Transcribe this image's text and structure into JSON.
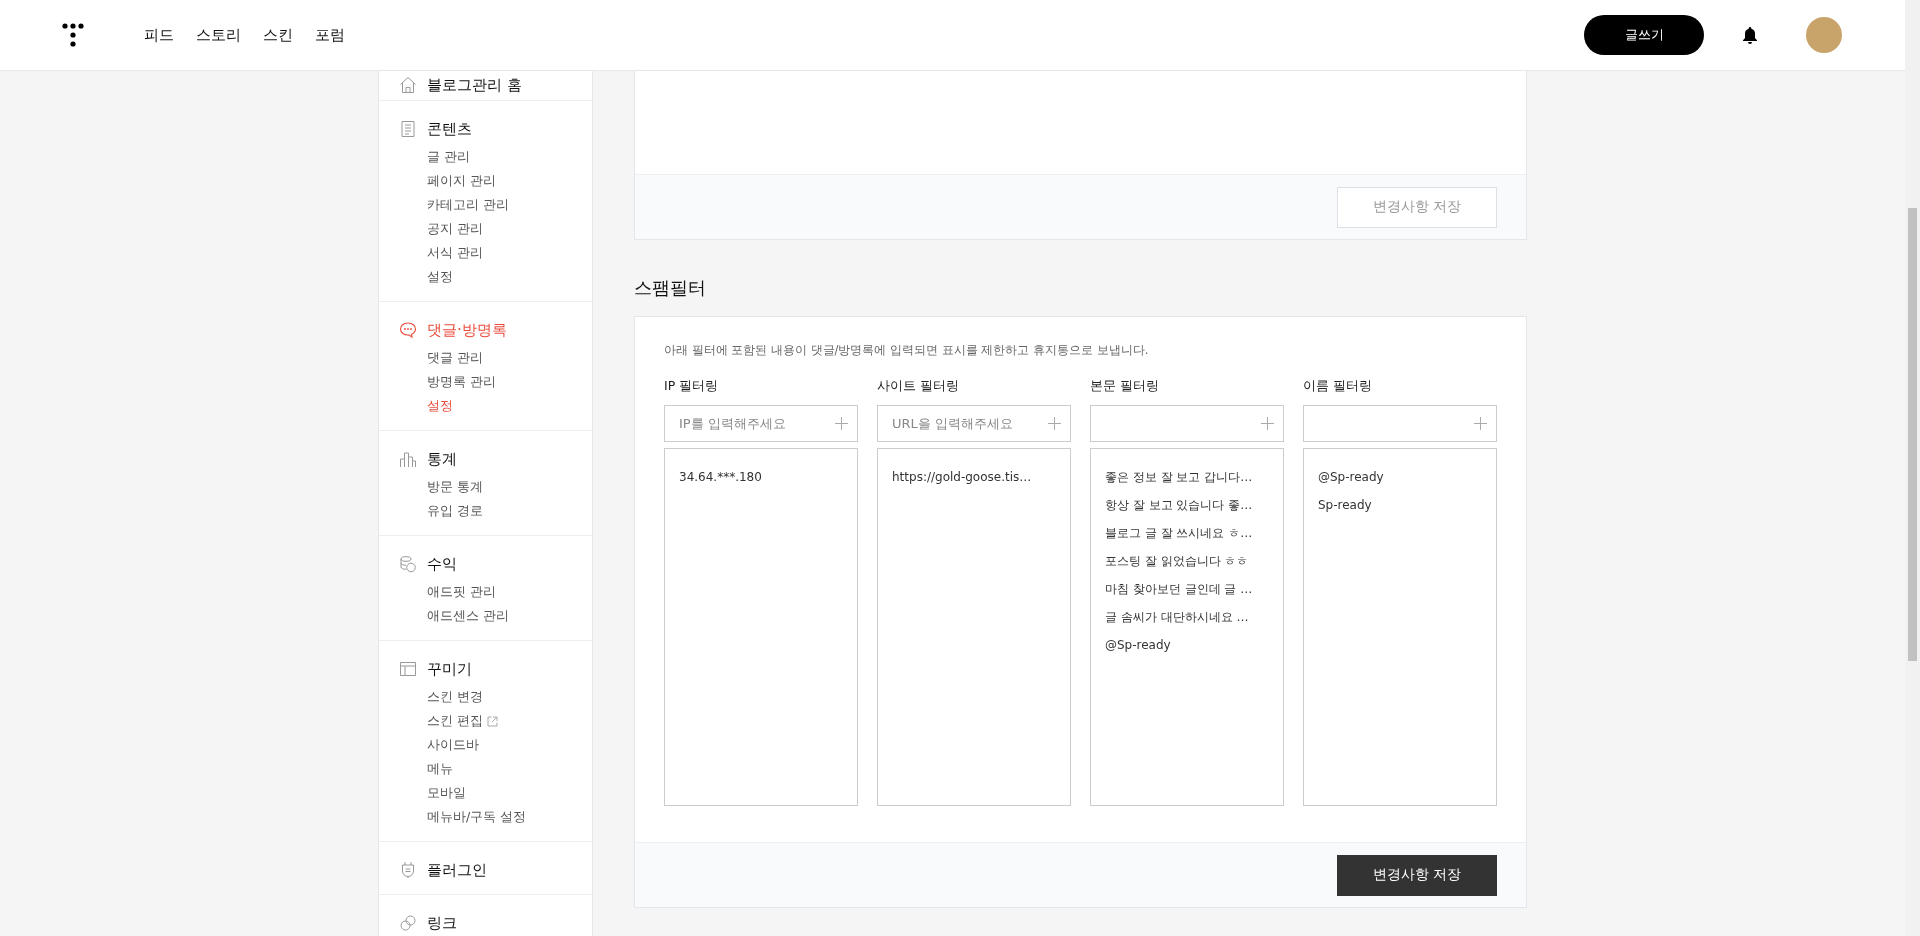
{
  "header": {
    "nav": [
      "피드",
      "스토리",
      "스킨",
      "포럼"
    ],
    "write_button": "글쓰기"
  },
  "sidebar": {
    "sections": [
      {
        "title": "블로그관리 홈",
        "active": false
      },
      {
        "title": "콘텐츠",
        "active": false,
        "items": [
          {
            "label": "글 관리",
            "selected": false,
            "external": false
          },
          {
            "label": "페이지 관리",
            "selected": false,
            "external": false
          },
          {
            "label": "카테고리 관리",
            "selected": false,
            "external": false
          },
          {
            "label": "공지 관리",
            "selected": false,
            "external": false
          },
          {
            "label": "서식 관리",
            "selected": false,
            "external": false
          },
          {
            "label": "설정",
            "selected": false,
            "external": false
          }
        ]
      },
      {
        "title": "댓글·방명록",
        "active": true,
        "items": [
          {
            "label": "댓글 관리",
            "selected": false,
            "external": false
          },
          {
            "label": "방명록 관리",
            "selected": false,
            "external": false
          },
          {
            "label": "설정",
            "selected": true,
            "external": false
          }
        ]
      },
      {
        "title": "통계",
        "active": false,
        "items": [
          {
            "label": "방문 통계",
            "selected": false,
            "external": false
          },
          {
            "label": "유입 경로",
            "selected": false,
            "external": false
          }
        ]
      },
      {
        "title": "수익",
        "active": false,
        "items": [
          {
            "label": "애드핏 관리",
            "selected": false,
            "external": false
          },
          {
            "label": "애드센스 관리",
            "selected": false,
            "external": false
          }
        ]
      },
      {
        "title": "꾸미기",
        "active": false,
        "items": [
          {
            "label": "스킨 변경",
            "selected": false,
            "external": false
          },
          {
            "label": "스킨 편집",
            "selected": false,
            "external": true
          },
          {
            "label": "사이드바",
            "selected": false,
            "external": false
          },
          {
            "label": "메뉴",
            "selected": false,
            "external": false
          },
          {
            "label": "모바일",
            "selected": false,
            "external": false
          },
          {
            "label": "메뉴바/구독 설정",
            "selected": false,
            "external": false
          }
        ]
      },
      {
        "title": "플러그인",
        "active": false
      },
      {
        "title": "링크",
        "active": false
      }
    ]
  },
  "top_card": {
    "save_button": {
      "label": "변경사항 저장",
      "disabled": true
    }
  },
  "spam_filter": {
    "title": "스팸필터",
    "description": "아래 필터에 포함된 내용이 댓글/방명록에 입력되면 표시를 제한하고 휴지통으로 보냅니다.",
    "filters": [
      {
        "label": "IP 필터링",
        "placeholder": "IP를 입력해주세요",
        "entries": [
          "34.64.***.180"
        ]
      },
      {
        "label": "사이트 필터링",
        "placeholder": "URL을 입력해주세요",
        "entries": [
          "https://gold-goose.tis…"
        ]
      },
      {
        "label": "본문 필터링",
        "entries": [
          "좋은 정보 잘 보고 갑니다…",
          "항상 잘 보고 있습니다 좋…",
          "블로그 글 잘 쓰시네요 ㅎ…",
          "포스팅 잘 읽었습니다 ㅎㅎ",
          "마침 찾아보던 글인데 글 …",
          "글 솜씨가 대단하시네요 …",
          "@Sp-ready"
        ]
      },
      {
        "label": "이름 필터링",
        "entries": [
          "@Sp-ready",
          "Sp-ready"
        ]
      }
    ],
    "save_button": {
      "label": "변경사항 저장",
      "disabled": false
    }
  }
}
